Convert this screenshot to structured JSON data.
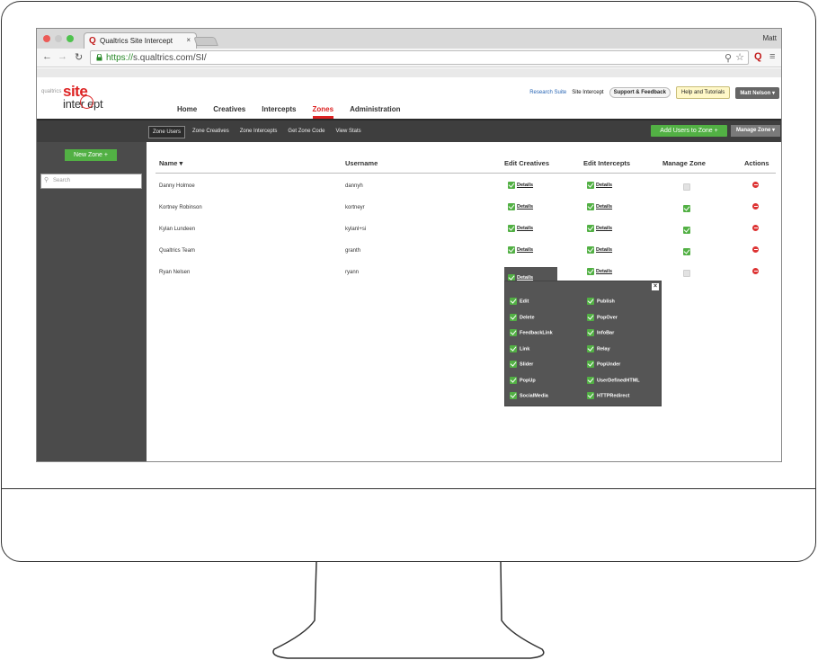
{
  "browser": {
    "tab_title": "Qualtrics Site Intercept",
    "tab_close": "×",
    "user": "Matt",
    "url_proto": "https://",
    "url_host": "s.qualtrics.com/SI/"
  },
  "app": {
    "logo_small": "qualtrics",
    "logo_site": "site",
    "logo_intercept": "inter   ept",
    "nav": [
      "Home",
      "Creatives",
      "Intercepts",
      "Zones",
      "Administration"
    ],
    "active_nav": "Zones",
    "top_links": {
      "research": "Research Suite",
      "site": "Site Intercept",
      "support": "Support & Feedback",
      "help": "Help and Tutorials",
      "user": "Matt Nelson ▾"
    },
    "subnav": [
      "Zone Users",
      "Zone Creatives",
      "Zone Intercepts",
      "Get Zone Code",
      "View Stats"
    ],
    "add_users": "Add Users to Zone +",
    "manage_zone": "Manage Zone ▾",
    "new_zone": "New Zone +",
    "search_placeholder": "Search"
  },
  "table": {
    "headers": [
      "Name ▾",
      "Username",
      "Edit Creatives",
      "Edit Intercepts",
      "Manage Zone",
      "Actions"
    ],
    "details_label": "Details",
    "rows": [
      {
        "name": "Danny Holmoe",
        "username": "dannyh",
        "manage": false
      },
      {
        "name": "Kortney Robinson",
        "username": "kortneyr",
        "manage": true
      },
      {
        "name": "Kylan Lundeen",
        "username": "kylanl+si",
        "manage": true
      },
      {
        "name": "Qualtrics Team",
        "username": "granth",
        "manage": true
      },
      {
        "name": "Ryan Nelsen",
        "username": "ryann",
        "manage": false
      }
    ]
  },
  "popover": {
    "close": "×",
    "left": [
      "Edit",
      "Delete",
      "FeedbackLink",
      "Link",
      "Slider",
      "PopUp",
      "SocialMedia"
    ],
    "right": [
      "Publish",
      "PopOver",
      "InfoBar",
      "Relay",
      "PopUnder",
      "UserDefinedHTML",
      "HTTPRedirect"
    ]
  },
  "colors": {
    "accent": "#d22",
    "green": "#52b044",
    "dark": "#3e3e3e"
  }
}
